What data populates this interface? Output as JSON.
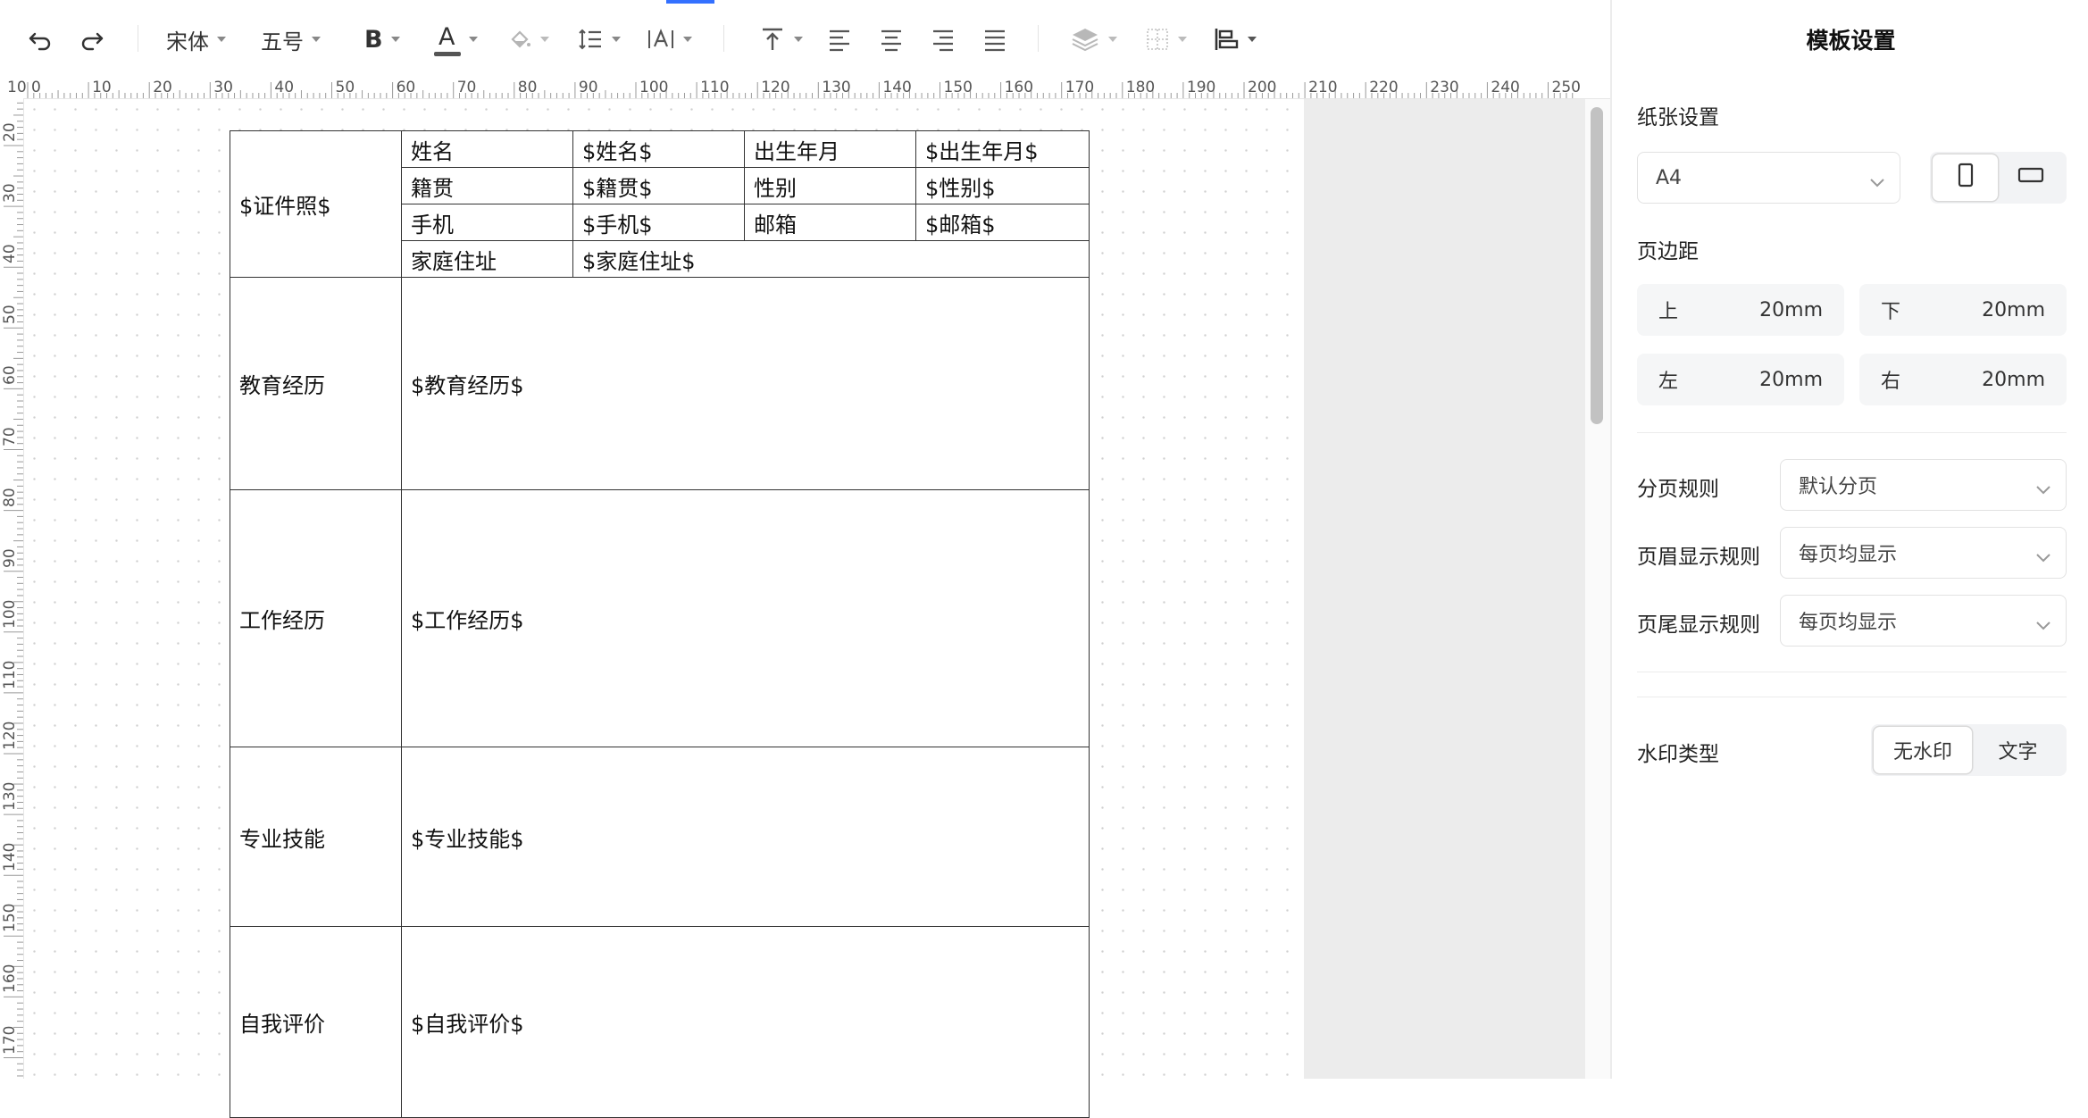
{
  "toolbar": {
    "undo_icon": "undo-icon",
    "redo_icon": "redo-icon",
    "font_family": "宋体",
    "font_size": "五号",
    "bold_label": "B",
    "font_color_label": "A",
    "font_color_underline": "#555555",
    "accent_color": "#3370ff"
  },
  "ruler": {
    "top_labels": [
      "10",
      "0",
      "10",
      "20",
      "30",
      "40",
      "50",
      "60",
      "70",
      "80",
      "90",
      "100",
      "110",
      "120",
      "130",
      "140",
      "150",
      "160",
      "170",
      "180",
      "190",
      "200",
      "210",
      "220",
      "230",
      "240",
      "250"
    ],
    "left_labels": [
      "20",
      "30",
      "40",
      "50",
      "60",
      "70",
      "80",
      "90",
      "100",
      "110",
      "120",
      "130",
      "140",
      "150",
      "160",
      "170"
    ]
  },
  "table": {
    "photo": "$证件照$",
    "name_label": "姓名",
    "name_value": "$姓名$",
    "birth_label": "出生年月",
    "birth_value": "$出生年月$",
    "origin_label": "籍贯",
    "origin_value": "$籍贯$",
    "gender_label": "性别",
    "gender_value": "$性别$",
    "phone_label": "手机",
    "phone_value": "$手机$",
    "email_label": "邮箱",
    "email_value": "$邮箱$",
    "address_label": "家庭住址",
    "address_value": "$家庭住址$",
    "education_label": "教育经历",
    "education_value": "$教育经历$",
    "work_label": "工作经历",
    "work_value": "$工作经历$",
    "skills_label": "专业技能",
    "skills_value": "$专业技能$",
    "self_label": "自我评价",
    "self_value": "$自我评价$"
  },
  "panel": {
    "title": "模板设置",
    "paper_section": "纸张设置",
    "paper_size": "A4",
    "margin_section": "页边距",
    "margins": {
      "top_label": "上",
      "top_value": "20mm",
      "bottom_label": "下",
      "bottom_value": "20mm",
      "left_label": "左",
      "left_value": "20mm",
      "right_label": "右",
      "right_value": "20mm"
    },
    "page_break_label": "分页规则",
    "page_break_value": "默认分页",
    "header_rule_label": "页眉显示规则",
    "header_rule_value": "每页均显示",
    "footer_rule_label": "页尾显示规则",
    "footer_rule_value": "每页均显示",
    "watermark_label": "水印类型",
    "watermark_none": "无水印",
    "watermark_text": "文字"
  }
}
